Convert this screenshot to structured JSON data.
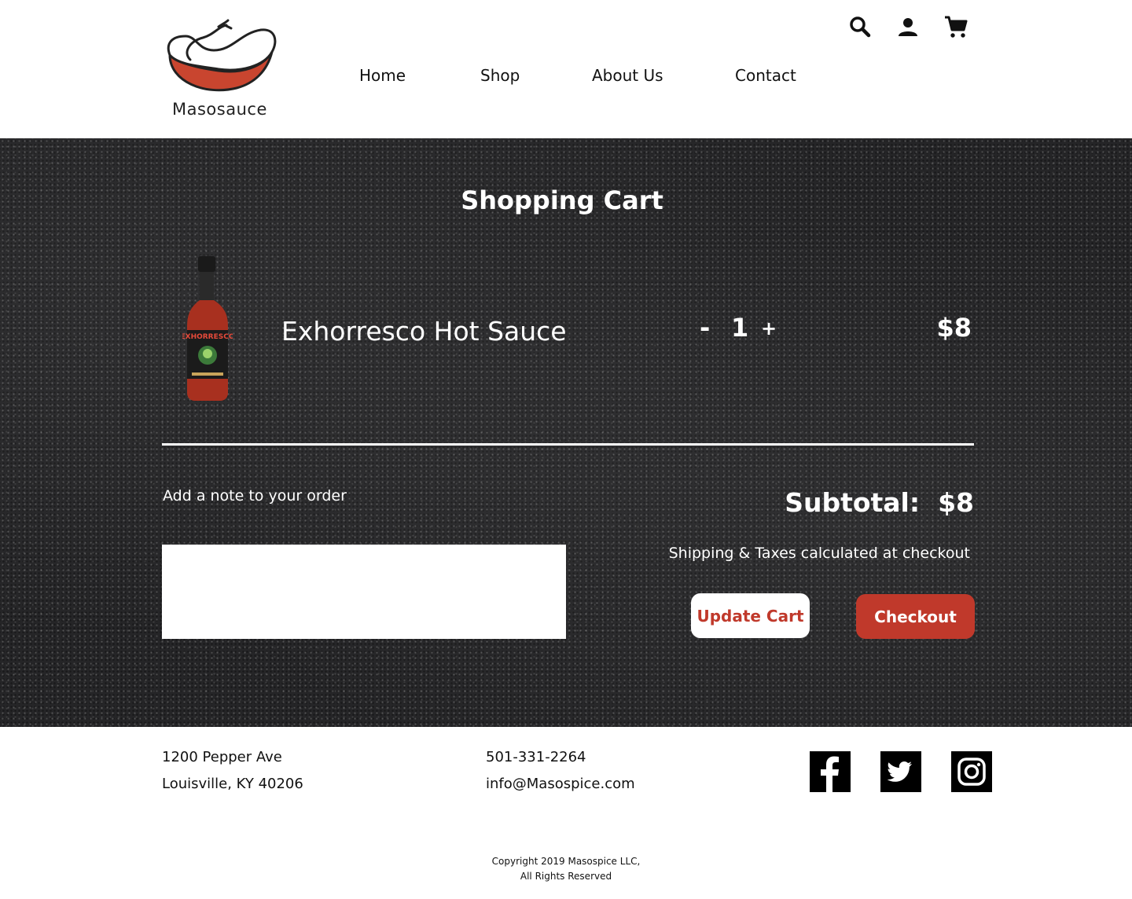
{
  "brand": {
    "name": "Masosauce",
    "logo_icon": "chili-pepper-logo",
    "accent_color": "#c0392b"
  },
  "nav": {
    "items": [
      {
        "label": "Home"
      },
      {
        "label": "Shop"
      },
      {
        "label": "About Us"
      },
      {
        "label": "Contact"
      }
    ]
  },
  "header_icons": [
    "search-icon",
    "user-icon",
    "cart-icon"
  ],
  "cart": {
    "title": "Shopping Cart",
    "items": [
      {
        "name": "Exhorresco Hot Sauce",
        "image_icon": "hot-sauce-bottle",
        "image_label": "EXHORRESCO",
        "quantity": "1",
        "minus_label": "-",
        "plus_label": "+",
        "price": "$8"
      }
    ],
    "note_label": "Add a note to your order",
    "note_value": "",
    "subtotal_label": "Subtotal:",
    "subtotal_value": "$8",
    "shipping_text": "Shipping & Taxes calculated at checkout",
    "update_label": "Update Cart",
    "checkout_label": "Checkout"
  },
  "footer": {
    "address_line1": "1200 Pepper Ave",
    "address_line2": "Louisville, KY 40206",
    "phone": "501-331-2264",
    "email": "info@Masospice.com",
    "social": [
      "facebook-icon",
      "twitter-icon",
      "instagram-icon"
    ],
    "copyright_line1": "Copyright 2019 Masospice LLC,",
    "copyright_line2": "All Rights Reserved"
  }
}
